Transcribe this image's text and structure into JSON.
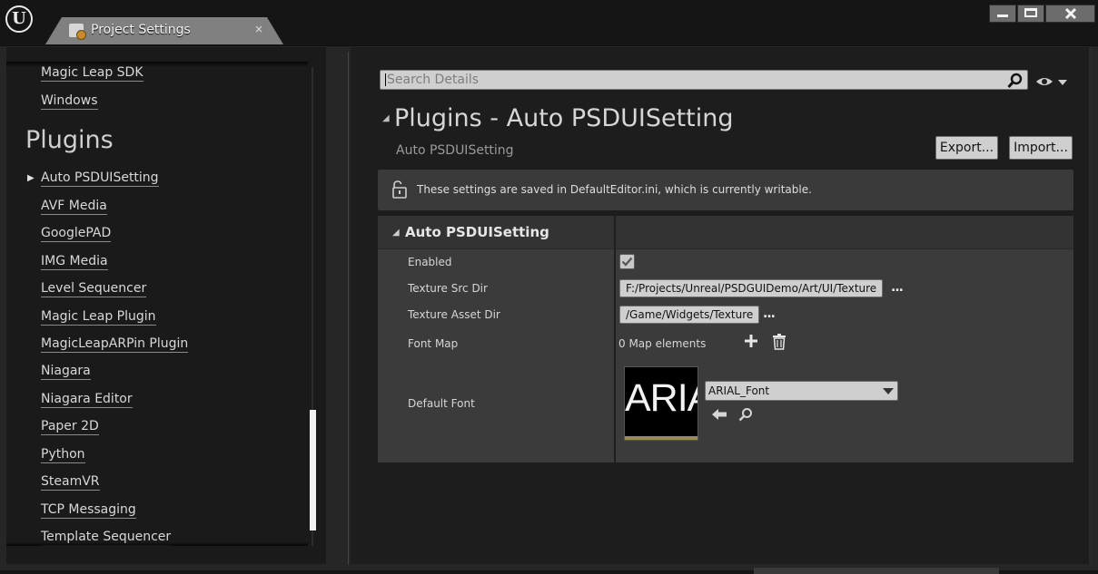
{
  "window": {
    "tab_title": "Project Settings",
    "tab_close": "×",
    "minimize_icon": "minimize-icon",
    "maximize_icon": "maximize-icon",
    "close_icon": "close-icon"
  },
  "sidebar": {
    "items_top": [
      "Magic Leap SDK",
      "Windows"
    ],
    "section": "Plugins",
    "items": [
      "Auto PSDUISetting",
      "AVF Media",
      "GooglePAD",
      "IMG Media",
      "Level Sequencer",
      "Magic Leap Plugin",
      "MagicLeapARPin Plugin",
      "Niagara",
      "Niagara Editor",
      "Paper 2D",
      "Python",
      "SteamVR",
      "TCP Messaging",
      "Template Sequencer"
    ]
  },
  "details": {
    "search_placeholder": "Search Details",
    "title": "Plugins - Auto PSDUISetting",
    "subtitle": "Auto PSDUISetting",
    "export_label": "Export...",
    "import_label": "Import...",
    "notice": "These settings are saved in DefaultEditor.ini, which is currently writable.",
    "category": "Auto PSDUISetting",
    "rows": {
      "enabled": {
        "label": "Enabled",
        "checked": true
      },
      "texture_src_dir": {
        "label": "Texture Src Dir",
        "value": "F:/Projects/Unreal/PSDGUIDemo/Art/UI/Texture"
      },
      "texture_asset_dir": {
        "label": "Texture Asset Dir",
        "value": "/Game/Widgets/Texture"
      },
      "font_map": {
        "label": "Font Map",
        "value": "0 Map elements"
      },
      "default_font": {
        "label": "Default Font",
        "value": "ARIAL_Font",
        "thumbnail_text": "ARIAL"
      }
    },
    "more_label": "..."
  },
  "colors": {
    "background": "#151515",
    "panel": "#1d1d1d",
    "category": "#3b3b3b",
    "field": "#cfcfcf"
  }
}
